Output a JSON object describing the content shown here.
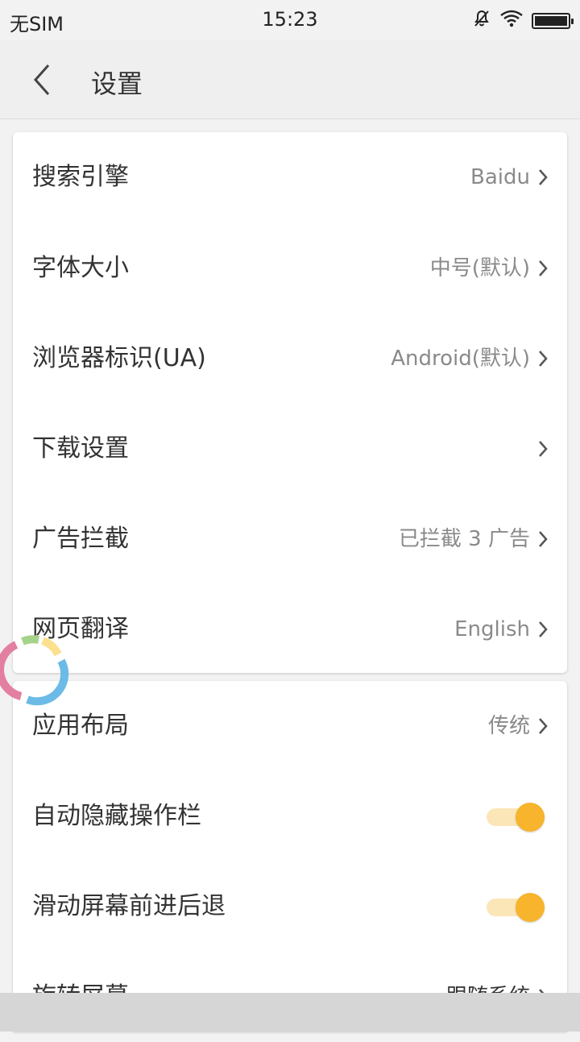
{
  "status_bar": {
    "carrier": "无SIM",
    "time": "15:23",
    "icons": [
      "mute-bell-icon",
      "wifi-icon",
      "battery-icon"
    ]
  },
  "header": {
    "back_icon": "back-arrow-icon",
    "title": "设置"
  },
  "card1": {
    "rows": [
      {
        "label": "搜索引擎",
        "value": "Baidu"
      },
      {
        "label": "字体大小",
        "value": "中号(默认)"
      },
      {
        "label": "浏览器标识(UA)",
        "value": "Android(默认)"
      },
      {
        "label": "下载设置",
        "value": ""
      },
      {
        "label": "广告拦截",
        "value": "已拦截 3 广告"
      },
      {
        "label": "网页翻译",
        "value": "English"
      }
    ]
  },
  "card2": {
    "rows": [
      {
        "label": "应用布局",
        "value": "传统"
      },
      {
        "label": "自动隐藏操作栏",
        "toggle": true
      },
      {
        "label": "滑动屏幕前进后退",
        "toggle": true
      },
      {
        "label": "旋转屏幕",
        "value": "跟随系统"
      }
    ]
  },
  "colors": {
    "accent": "#f7b42c",
    "toggle_track": "#fbe6b8",
    "background": "#f2f2f2"
  }
}
